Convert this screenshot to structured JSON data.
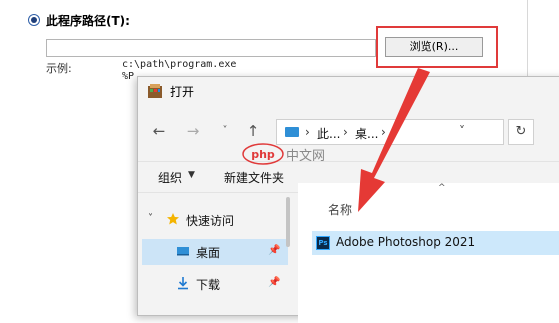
{
  "run_dialog": {
    "program_path_label": "此程序路径(T):",
    "browse_button": "浏览(R)...",
    "example_label": "示例:",
    "example_line1": "c:\\path\\program.exe",
    "example_line2": "%P"
  },
  "open_dialog": {
    "title": "打开",
    "address": {
      "seg1": "此...",
      "seg2": "桌..."
    },
    "commands": {
      "organize": "组织",
      "new_folder": "新建文件夹"
    },
    "nav": {
      "quick_access": "快速访问",
      "desktop": "桌面",
      "downloads": "下载"
    },
    "column_name": "名称",
    "files": [
      {
        "name": "Adobe Photoshop 2021"
      }
    ]
  },
  "watermark": {
    "text": "中文网",
    "logo": "php"
  },
  "colors": {
    "highlight": "#e03a3a",
    "selection": "#cde8fb",
    "folder": "#2f8fd6"
  }
}
